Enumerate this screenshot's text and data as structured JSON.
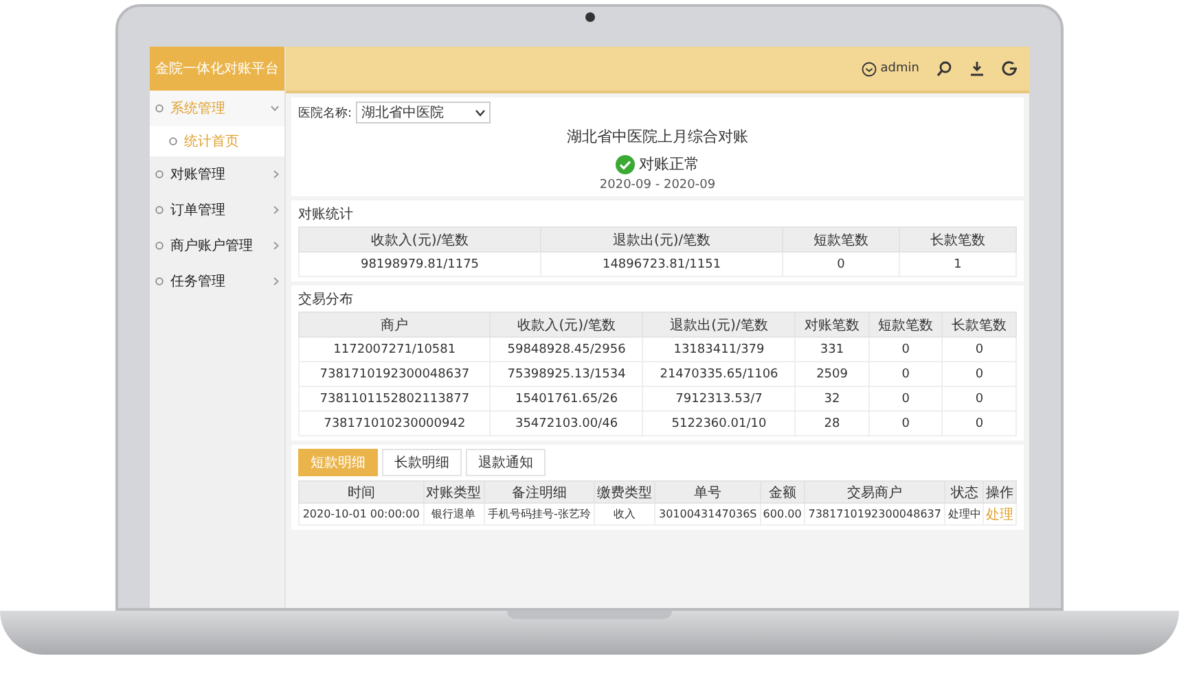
{
  "app": {
    "title": "金院一体化对账平台",
    "user": "admin"
  },
  "sidebar": {
    "items": [
      {
        "label": "系统管理",
        "selected": true,
        "expanded": true,
        "children": [
          {
            "label": "统计首页",
            "selected": true
          }
        ]
      },
      {
        "label": "对账管理",
        "selected": false,
        "expanded": false
      },
      {
        "label": "订单管理",
        "selected": false,
        "expanded": false
      },
      {
        "label": "商户账户管理",
        "selected": false,
        "expanded": false
      },
      {
        "label": "任务管理",
        "selected": false,
        "expanded": false
      }
    ]
  },
  "summary": {
    "filter_label": "医院名称:",
    "filter_value": "湖北省中医院",
    "title": "湖北省中医院上月综合对账",
    "status": "对账正常",
    "ok": true,
    "period": "2020-09 - 2020-09"
  },
  "stats": {
    "title": "对账统计",
    "columns": [
      "收款入(元)/笔数",
      "退款出(元)/笔数",
      "短款笔数",
      "长款笔数"
    ],
    "rows": [
      [
        "98198979.81/1175",
        "14896723.81/1151",
        "0",
        "1"
      ]
    ]
  },
  "distribution": {
    "title": "交易分布",
    "columns": [
      "商户",
      "收款入(元)/笔数",
      "退款出(元)/笔数",
      "对账笔数",
      "短款笔数",
      "长款笔数"
    ],
    "rows": [
      [
        "1172007271/10581",
        "59848928.45/2956",
        "13183411/379",
        "331",
        "0",
        "0"
      ],
      [
        "7381710192300048637",
        "75398925.13/1534",
        "21470335.65/1106",
        "2509",
        "0",
        "0"
      ],
      [
        "7381101152802113877",
        "15401761.65/26",
        "7912313.53/7",
        "32",
        "0",
        "0"
      ],
      [
        "738171010230000942",
        "35472103.00/46",
        "5122360.01/10",
        "28",
        "0",
        "0"
      ]
    ]
  },
  "tabs": [
    {
      "label": "短款明细",
      "selected": true
    },
    {
      "label": "长款明细",
      "selected": false
    },
    {
      "label": "退款通知",
      "selected": false
    }
  ],
  "detail": {
    "columns": [
      "时间",
      "对账类型",
      "备注明细",
      "缴费类型",
      "单号",
      "金额",
      "交易商户",
      "状态",
      "操作"
    ],
    "rows": [
      {
        "cells": [
          "2020-10-01 00:00:00",
          "银行退单",
          "手机号码挂号-张艺玲",
          "收入",
          "3010043147036S",
          "600.00",
          "7381710192300048637",
          "处理中"
        ],
        "action": "处理"
      }
    ]
  }
}
